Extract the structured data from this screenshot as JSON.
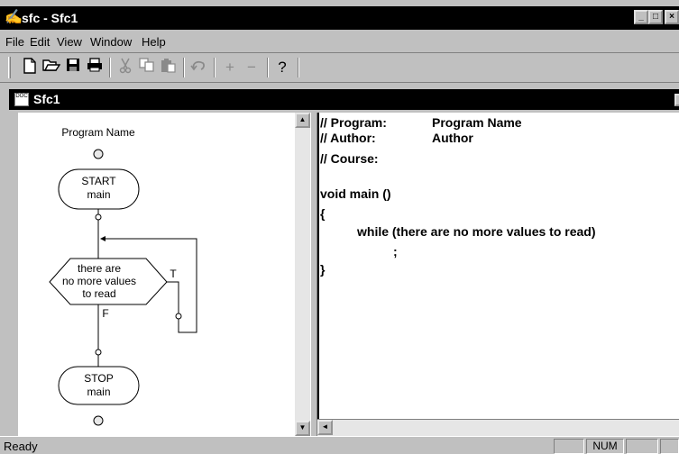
{
  "window": {
    "title": "sfc - Sfc1",
    "app_icon": "sfc-app-icon"
  },
  "menu": [
    "File",
    "Edit",
    "View",
    "Window",
    "Help"
  ],
  "toolbar": {
    "buttons": [
      "new-file-icon",
      "open-folder-icon",
      "save-disk-icon",
      "print-icon",
      "cut-icon",
      "copy-icon",
      "paste-icon",
      "undo-icon",
      "plus-icon",
      "minus-icon",
      "help-icon"
    ],
    "plus_label": "+",
    "minus_label": "−",
    "help_label": "?"
  },
  "document": {
    "title": "Sfc1",
    "icon": "document-icon"
  },
  "flowchart": {
    "program_name": "Program Name",
    "start_line1": "START",
    "start_line2": "main",
    "decision_line1": "there are",
    "decision_line2": "no more values",
    "decision_line3": "to read",
    "true_label": "T",
    "false_label": "F",
    "stop_line1": "STOP",
    "stop_line2": "main"
  },
  "code": {
    "program_label": "// Program:",
    "program_value": "Program Name",
    "author_label": "// Author:",
    "author_value": "Author",
    "course_label": "// Course:",
    "main_signature": "void main ()",
    "open_brace": "{",
    "while_line": "while (there are no more values to read)",
    "semicolon": ";",
    "close_brace": "}"
  },
  "status": {
    "text": "Ready",
    "num": "NUM"
  }
}
